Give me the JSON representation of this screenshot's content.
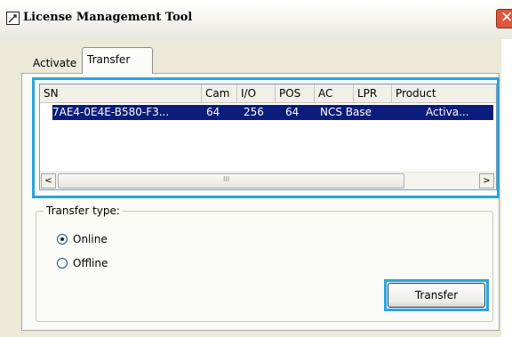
{
  "window": {
    "title": "License Management Tool"
  },
  "tabs": [
    {
      "label": "Activate",
      "selected": false
    },
    {
      "label": "Transfer",
      "selected": true
    }
  ],
  "list": {
    "columns": [
      "SN",
      "Cam",
      "I/O",
      "POS",
      "AC",
      "LPR",
      "Product"
    ],
    "rows": [
      {
        "cells": [
          "7AE4-0E4E-B580-F3...",
          "64",
          "256",
          "64",
          "NCS Base",
          "Activa..."
        ],
        "selected": true
      }
    ],
    "scroll_left_glyph": "<",
    "scroll_right_glyph": ">",
    "scroll_grip_glyph": "III"
  },
  "transfer_type": {
    "label": "Transfer type:",
    "options": [
      {
        "label": "Online",
        "checked": true
      },
      {
        "label": "Offline",
        "checked": false
      }
    ]
  },
  "buttons": {
    "transfer": "Transfer"
  },
  "icons": {
    "app": "license-tool-icon",
    "close": "close-icon",
    "scroll_left": "scroll-left-arrow-icon",
    "scroll_right": "scroll-right-arrow-icon"
  },
  "colors": {
    "selection": "#0b1c7a",
    "highlight_outline": "#2aa3dd",
    "close_button": "#e0553c",
    "dialog_background": "#ece9d8"
  }
}
